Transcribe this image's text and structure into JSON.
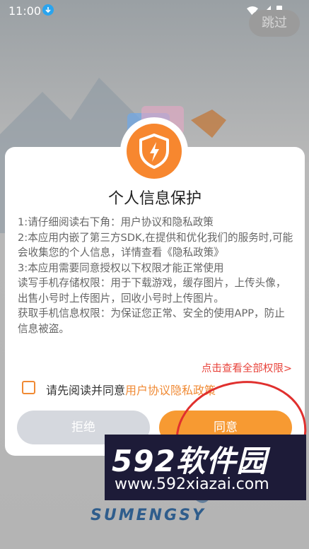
{
  "status_bar": {
    "time": "11:00"
  },
  "skip_button": {
    "label": "跳过"
  },
  "dialog": {
    "title": "个人信息保护",
    "body": [
      "1:请仔细阅读右下角：用户协议和隐私政策",
      "2:本应用内嵌了第三方SDK,在提供和优化我们的服务时,可能会收集您的个人信息，详情查看《隐私政策》",
      "3:本应用需要同意授权以下权限才能正常使用",
      "读写手机存储权限：用于下载游戏，缓存图片，上传头像，出售小号时上传图片，回收小号时上传图片。",
      "获取手机信息权限：为保证您正常、安全的使用APP，防止信息被盗。"
    ],
    "view_all_permissions": "点击查看全部权限>",
    "agree_prefix": "请先阅读并同意",
    "agree_link": "用户协议隐私政策",
    "reject_label": "拒绝",
    "agree_label": "同意"
  },
  "watermark": {
    "top_text": "592软件园",
    "bottom_text": "www.592xiazai.com"
  },
  "background_logo": {
    "subtitle": "SUMENGSY"
  },
  "colors": {
    "accent": "#f79a32",
    "link_red": "#e8443c",
    "reject_bg": "#d5d8de"
  }
}
